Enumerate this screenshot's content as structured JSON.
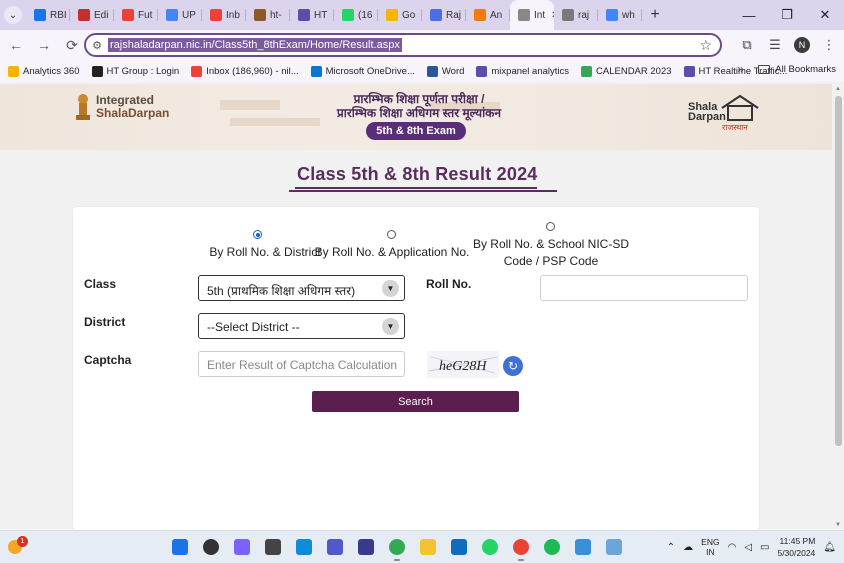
{
  "tabs": [
    {
      "label": "RBI",
      "color": "#1a73e8"
    },
    {
      "label": "Edi",
      "color": "#c4302b"
    },
    {
      "label": "Fut",
      "color": "#ea4335"
    },
    {
      "label": "UP",
      "color": "#4285f4"
    },
    {
      "label": "Inb",
      "color": "#ea4335"
    },
    {
      "label": "ht-",
      "color": "#8b5a2b"
    },
    {
      "label": "HT",
      "color": "#5b4ea8"
    },
    {
      "label": "(16",
      "color": "#25d366"
    },
    {
      "label": "Go",
      "color": "#f4b400"
    },
    {
      "label": "Raj",
      "color": "#4a6fe3"
    },
    {
      "label": "An",
      "color": "#f57c00"
    },
    {
      "label": "Int",
      "color": "#888888"
    },
    {
      "label": "raj",
      "color": "#7a7a7a"
    },
    {
      "label": "wh",
      "color": "#4285f4"
    }
  ],
  "window_controls": {
    "minimize": "—",
    "maximize": "❐",
    "close": "✕"
  },
  "address_bar": {
    "url": "rajshaladarpan.nic.in/Class5th_8thExam/Home/Result.aspx"
  },
  "profile_initial": "N",
  "bookmarks": [
    {
      "label": "Analytics 360",
      "color": "#f4b400"
    },
    {
      "label": "HT Group : Login",
      "color": "#222222"
    },
    {
      "label": "Inbox (186,960) - nil...",
      "color": "#ea4335"
    },
    {
      "label": "Microsoft OneDrive...",
      "color": "#0078d4"
    },
    {
      "label": "Word",
      "color": "#2b579a"
    },
    {
      "label": "mixpanel analytics",
      "color": "#5b4ea8"
    },
    {
      "label": "CALENDAR 2023",
      "color": "#34a853"
    },
    {
      "label": "HT Realtime Traffic...",
      "color": "#5b4ea8"
    }
  ],
  "bookmarks_more": "»",
  "all_bookmarks": "All Bookmarks",
  "banner": {
    "brand_line1": "Integrated",
    "brand_line2": "ShalaDarpan",
    "hindi_line1": "प्रारम्भिक शिक्षा पूर्णता परीक्षा /",
    "hindi_line2": "प्रारम्भिक शिक्षा अधिगम स्तर मूल्यांकन",
    "exam_pill": "5th & 8th Exam",
    "right_logo_line1": "Shala",
    "right_logo_line2": "Darpan",
    "right_logo_hindi": "राजस्थान"
  },
  "page_title": "Class 5th & 8th Result 2024",
  "search_modes": [
    {
      "label": "By Roll No. & District",
      "selected": true
    },
    {
      "label": "By Roll No. & Application No.",
      "selected": false
    },
    {
      "label_line1": "By Roll No. & School NIC-SD",
      "label_line2": "Code / PSP Code",
      "selected": false
    }
  ],
  "form": {
    "class_label": "Class",
    "class_value": "5th (प्राथमिक शिक्षा अधिगम स्तर)",
    "roll_label": "Roll No.",
    "roll_value": "",
    "district_label": "District",
    "district_value": "--Select District --",
    "captcha_label": "Captcha",
    "captcha_placeholder": "Enter Result of Captcha Calculation",
    "captcha_text": "heG28H",
    "search_label": "Search"
  },
  "taskbar": {
    "notification_count": "1",
    "language_line1": "ENG",
    "language_line2": "IN",
    "time": "11:45 PM",
    "date": "5/30/2024"
  },
  "taskbar_apps": [
    {
      "name": "start",
      "color": "#1a73e8"
    },
    {
      "name": "search",
      "color": "#333333"
    },
    {
      "name": "widgets",
      "color": "#7b61ff"
    },
    {
      "name": "task-view",
      "color": "#444444"
    },
    {
      "name": "edge",
      "color": "#0c8cd8"
    },
    {
      "name": "teams",
      "color": "#5059c9"
    },
    {
      "name": "store",
      "color": "#3a3a8c"
    },
    {
      "name": "chrome",
      "color": "#34a853"
    },
    {
      "name": "explorer",
      "color": "#f4c430"
    },
    {
      "name": "mail",
      "color": "#0f6cbd"
    },
    {
      "name": "whatsapp",
      "color": "#25d366"
    },
    {
      "name": "chrome-profile",
      "color": "#ea4335"
    },
    {
      "name": "spotify",
      "color": "#1db954"
    },
    {
      "name": "photos",
      "color": "#3a8fd9"
    },
    {
      "name": "notepad",
      "color": "#6aa6d9"
    }
  ]
}
